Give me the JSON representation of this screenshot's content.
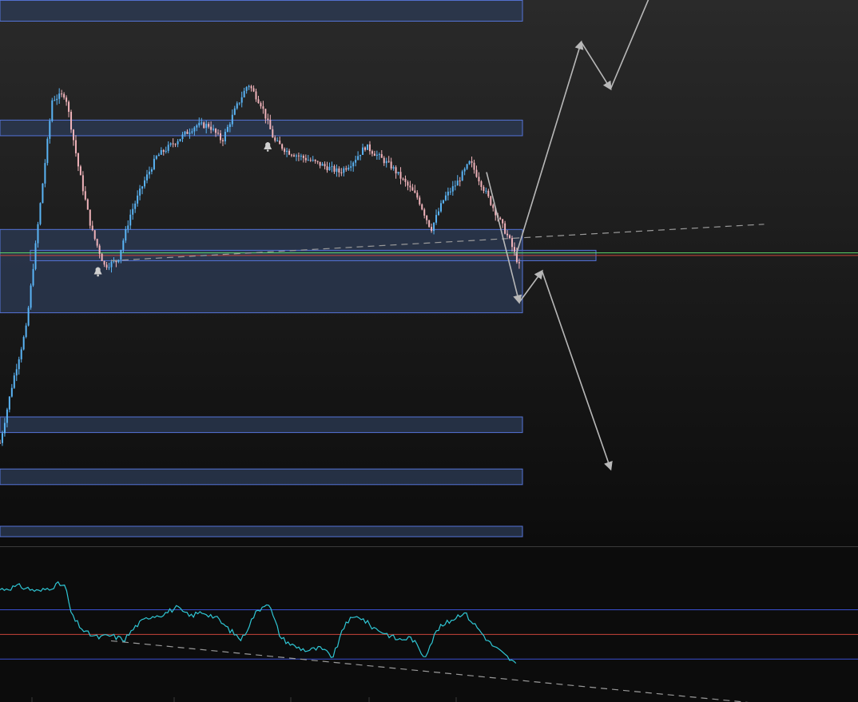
{
  "colors": {
    "bg_top": "#2a2a2a",
    "bg_bottom": "#0c0c0c",
    "candle_up": "#5ab4f5",
    "candle_down": "#f0b3ba",
    "zone_fill": "#2c3b55",
    "zone_stroke": "#5574d8",
    "projection": "#b8b8b8",
    "trendline": "#9a9a9a",
    "green_line": "#5ed86b",
    "red_line": "#c8443a",
    "oscillator": "#2fc6d4",
    "osc_band": "#3a4fd0",
    "osc_mid": "#c8443a",
    "separator": "#3a3a3a",
    "alert_icon": "#cfcfcf"
  },
  "chart_data": [
    {
      "type": "candlestick",
      "title": "",
      "xlabel": "",
      "ylabel": "",
      "axes_visible": false,
      "grid": false,
      "x_range": [
        0,
        160
      ],
      "y_range": [
        0,
        100
      ],
      "key_points": [
        [
          0,
          18
        ],
        [
          4,
          30
        ],
        [
          8,
          40
        ],
        [
          12,
          62
        ],
        [
          16,
          84
        ],
        [
          20,
          85
        ],
        [
          24,
          71
        ],
        [
          28,
          59
        ],
        [
          32,
          52
        ],
        [
          36,
          53
        ],
        [
          40,
          62
        ],
        [
          44,
          68
        ],
        [
          48,
          73
        ],
        [
          52,
          75
        ],
        [
          56,
          77
        ],
        [
          60,
          79
        ],
        [
          64,
          79
        ],
        [
          68,
          76
        ],
        [
          72,
          82
        ],
        [
          76,
          87
        ],
        [
          80,
          83
        ],
        [
          84,
          76
        ],
        [
          88,
          74
        ],
        [
          92,
          73
        ],
        [
          96,
          72
        ],
        [
          100,
          71
        ],
        [
          104,
          70
        ],
        [
          108,
          72
        ],
        [
          112,
          75
        ],
        [
          116,
          73
        ],
        [
          120,
          71
        ],
        [
          124,
          68
        ],
        [
          128,
          65
        ],
        [
          132,
          59
        ],
        [
          136,
          65
        ],
        [
          140,
          68
        ],
        [
          144,
          72
        ],
        [
          148,
          67
        ],
        [
          152,
          62
        ],
        [
          156,
          57
        ],
        [
          159,
          52
        ]
      ],
      "zones": [
        {
          "low": 99,
          "high": 103,
          "extends_right": false
        },
        {
          "low": 77,
          "high": 80,
          "extends_right": false
        },
        {
          "low": 43,
          "high": 59,
          "extends_right": false
        },
        {
          "low": 53,
          "high": 55,
          "extends_right": true
        },
        {
          "low": 20,
          "high": 23,
          "extends_right": false
        },
        {
          "low": 10,
          "high": 13,
          "extends_right": false
        },
        {
          "low": 0,
          "high": 2,
          "extends_right": false
        }
      ],
      "horizontal_lines": [
        {
          "value": 54.5,
          "color": "green"
        },
        {
          "value": 54.0,
          "color": "red"
        }
      ],
      "trendline": {
        "from": [
          34,
          53
        ],
        "to": [
          234,
          60
        ],
        "style": "dashed"
      },
      "alerts": [
        [
          30,
          51
        ],
        [
          82,
          75
        ]
      ],
      "projections": [
        {
          "path": [
            [
              158,
              54
            ],
            [
              178,
              95
            ],
            [
              187,
              86
            ],
            [
              214,
              126
            ]
          ]
        },
        {
          "path": [
            [
              149,
              70
            ],
            [
              159,
              45
            ],
            [
              166,
              51
            ],
            [
              187,
              13
            ]
          ]
        }
      ]
    },
    {
      "type": "line",
      "title": "",
      "axes_visible": false,
      "grid": false,
      "x_range": [
        0,
        160
      ],
      "y_range": [
        0,
        100
      ],
      "key_points": [
        [
          0,
          85
        ],
        [
          6,
          88
        ],
        [
          12,
          83
        ],
        [
          18,
          90
        ],
        [
          20,
          88
        ],
        [
          22,
          60
        ],
        [
          26,
          45
        ],
        [
          30,
          40
        ],
        [
          34,
          42
        ],
        [
          38,
          38
        ],
        [
          42,
          52
        ],
        [
          46,
          60
        ],
        [
          50,
          62
        ],
        [
          54,
          68
        ],
        [
          58,
          60
        ],
        [
          62,
          64
        ],
        [
          66,
          59
        ],
        [
          70,
          48
        ],
        [
          74,
          38
        ],
        [
          78,
          62
        ],
        [
          82,
          74
        ],
        [
          86,
          40
        ],
        [
          90,
          32
        ],
        [
          94,
          28
        ],
        [
          98,
          30
        ],
        [
          102,
          22
        ],
        [
          106,
          55
        ],
        [
          110,
          60
        ],
        [
          114,
          50
        ],
        [
          118,
          44
        ],
        [
          122,
          38
        ],
        [
          126,
          40
        ],
        [
          130,
          22
        ],
        [
          134,
          48
        ],
        [
          138,
          56
        ],
        [
          142,
          64
        ],
        [
          146,
          50
        ],
        [
          150,
          35
        ],
        [
          154,
          25
        ],
        [
          158,
          15
        ]
      ],
      "levels": [
        {
          "value": 66,
          "color": "blue"
        },
        {
          "value": 43,
          "color": "red"
        },
        {
          "value": 20,
          "color": "blue"
        }
      ],
      "trendline": {
        "from": [
          34,
          37
        ],
        "to": [
          234,
          -22
        ],
        "style": "dashed"
      }
    }
  ]
}
